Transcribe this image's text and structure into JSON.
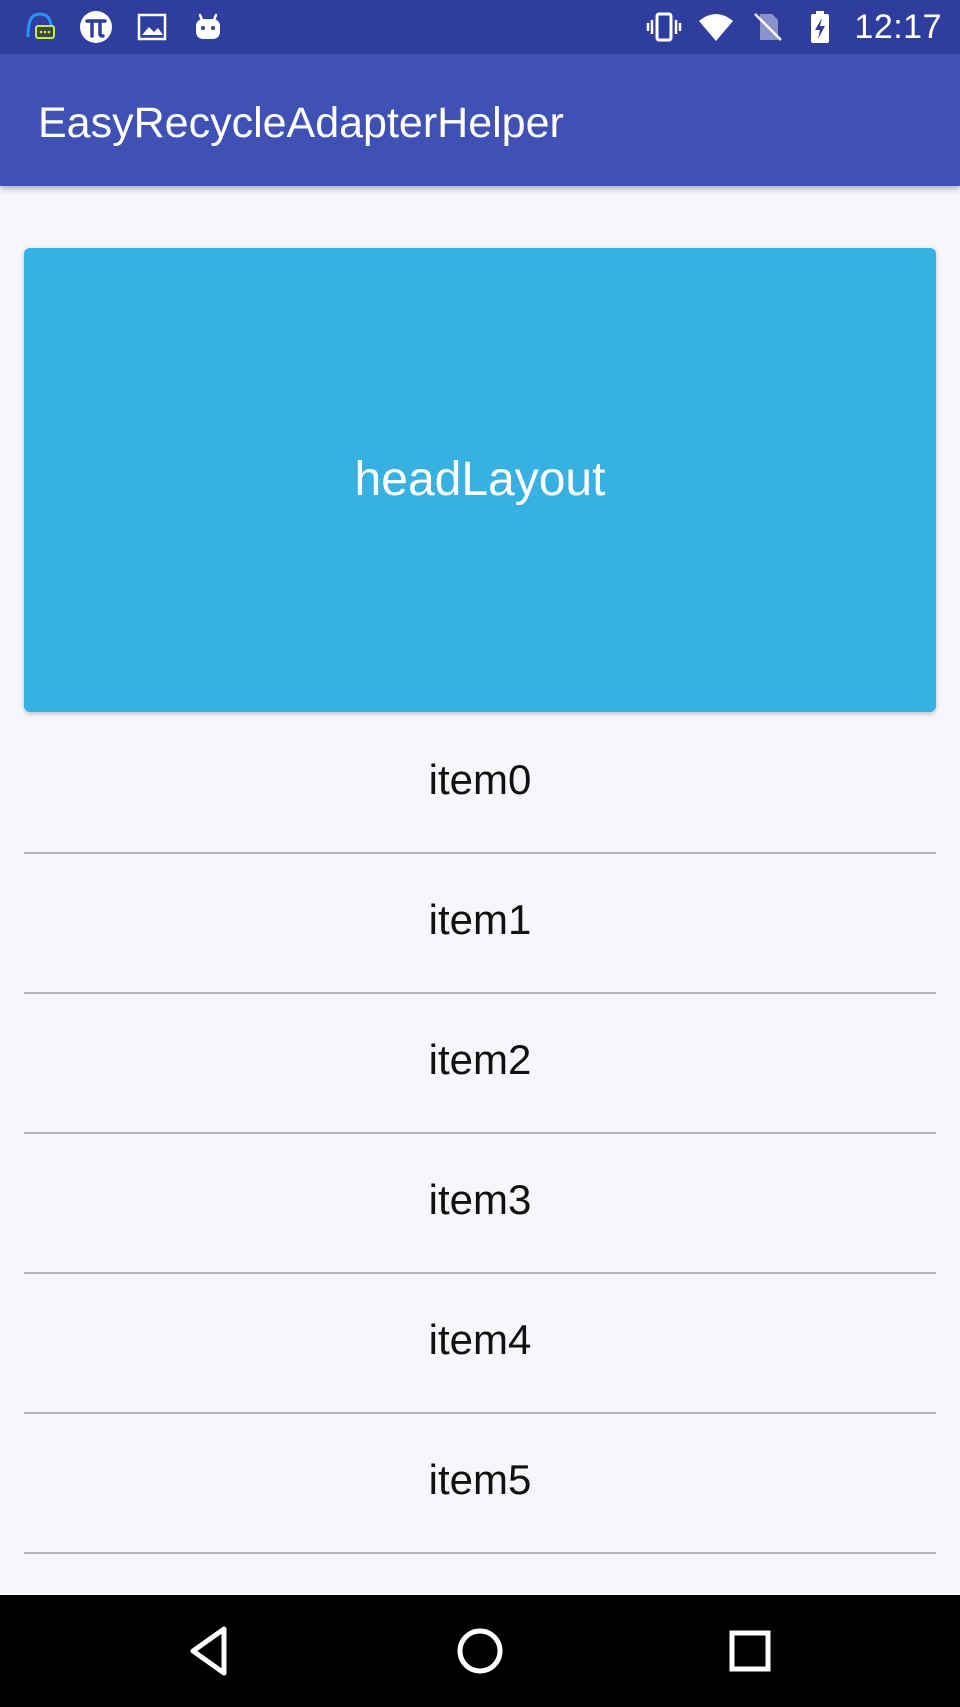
{
  "status_bar": {
    "time": "12:17",
    "left_icons": [
      "chat-notification-icon",
      "pi-icon",
      "image-icon",
      "android-icon"
    ],
    "right_icons": [
      "vibrate-icon",
      "wifi-icon",
      "no-sim-icon",
      "battery-charging-icon"
    ],
    "background": "#2f3e9e"
  },
  "app_bar": {
    "title": "EasyRecycleAdapterHelper",
    "background": "#3f51b5"
  },
  "header": {
    "label": "headLayout",
    "background": "#37b1e2"
  },
  "list": {
    "items": [
      {
        "label": "item0"
      },
      {
        "label": "item1"
      },
      {
        "label": "item2"
      },
      {
        "label": "item3"
      },
      {
        "label": "item4"
      },
      {
        "label": "item5"
      }
    ]
  },
  "nav_bar": {
    "buttons": [
      "back-icon",
      "home-icon",
      "recents-icon"
    ]
  }
}
